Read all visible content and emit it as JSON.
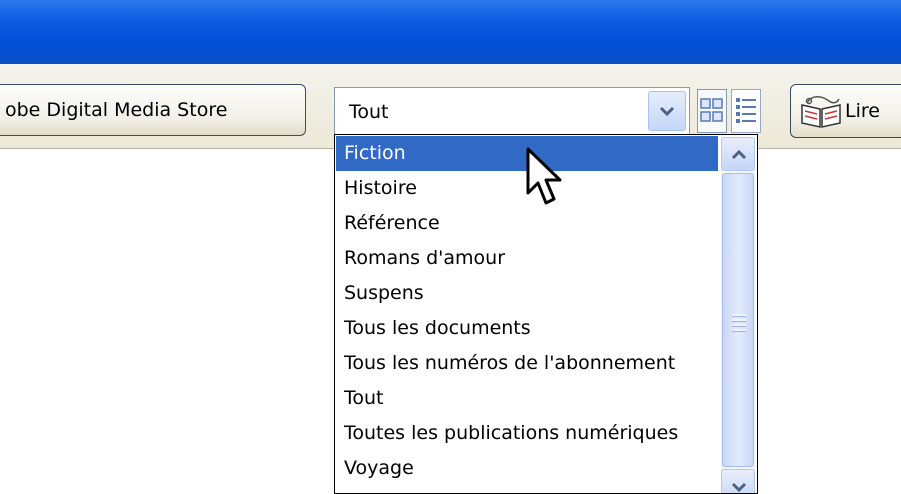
{
  "toolbar": {
    "store_button_label": "obe Digital Media Store",
    "filter_combo_value": "Tout",
    "lire_button_label": "Lire"
  },
  "dropdown": {
    "selected_index": 0,
    "options": [
      "Fiction",
      "Histoire",
      "Référence",
      "Romans d'amour",
      "Suspens",
      "Tous les documents",
      "Tous les numéros de l'abonnement",
      "Tout",
      "Toutes les publications numériques",
      "Voyage"
    ]
  },
  "icons": {
    "combo_arrow": "chevron-down-icon",
    "thumbnail_view": "thumbnail-view-icon",
    "list_view": "list-view-icon",
    "read": "read-book-icon",
    "scroll_up": "chevron-up-icon",
    "scroll_down": "chevron-down-icon",
    "pointer": "mouse-pointer-icon"
  },
  "colors": {
    "title_bar": "#0a5ae0",
    "toolbar_bg": "#ece9d8",
    "selection": "#316ac5",
    "scrollbar": "#c5d5f6"
  }
}
